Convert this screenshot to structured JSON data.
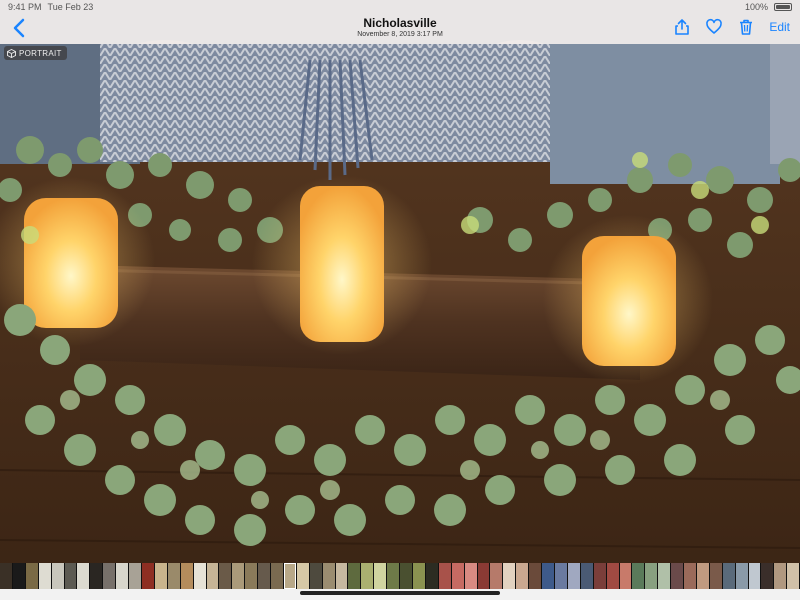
{
  "status_bar": {
    "time": "9:41 PM",
    "date": "Tue Feb 23",
    "battery_percent": "100%",
    "battery_level": 1.0
  },
  "nav": {
    "title": "Nicholasville",
    "subtitle": "November 8, 2019  3:17 PM",
    "edit_label": "Edit",
    "icons": [
      "back-chevron-icon",
      "share-icon",
      "heart-icon",
      "trash-icon"
    ],
    "accent_color": "#1a84ff"
  },
  "photo": {
    "badge_label": "PORTRAIT",
    "badge_icon": "cube-icon"
  },
  "thumbnails": {
    "count": 62,
    "colors": [
      "#3a3026",
      "#1a1a1a",
      "#7a6a45",
      "#dedcd2",
      "#c8c6bc",
      "#5c5a52",
      "#dcdad0",
      "#2a2622",
      "#77706a",
      "#d8d6cc",
      "#a8a296",
      "#8e2e22",
      "#c9b48c",
      "#9a8a6a",
      "#b48c5c",
      "#e6e2d6",
      "#c6b496",
      "#6a5a48",
      "#aa9a7a",
      "#8a7a5a",
      "#665a4c",
      "#7a6a50",
      "#b8a888",
      "#d6c8a6",
      "#4e4a3e",
      "#9a8c70",
      "#c6b8a0",
      "#5e6a3e",
      "#aab070",
      "#d0d4a0",
      "#6e7a48",
      "#4a5030",
      "#8a9250",
      "#2c2c22",
      "#a8524a",
      "#c66a62",
      "#d88a82",
      "#8a3a34",
      "#b67a6a",
      "#e2d2c0",
      "#caa890",
      "#6a4a3a",
      "#3e5a8a",
      "#6a7aa0",
      "#a0a8c0",
      "#4a5a74",
      "#7a3e3a",
      "#a04a42",
      "#c87a6a",
      "#5a7a5a",
      "#88a080",
      "#b0c0a8",
      "#6a4a4a",
      "#9a6a5a",
      "#c09a80",
      "#7a5a4a",
      "#5a6a7a",
      "#8a9aa8",
      "#c0c8d0",
      "#3a2e2a",
      "#b09880",
      "#d0c0a8"
    ],
    "selected_index": 22
  }
}
